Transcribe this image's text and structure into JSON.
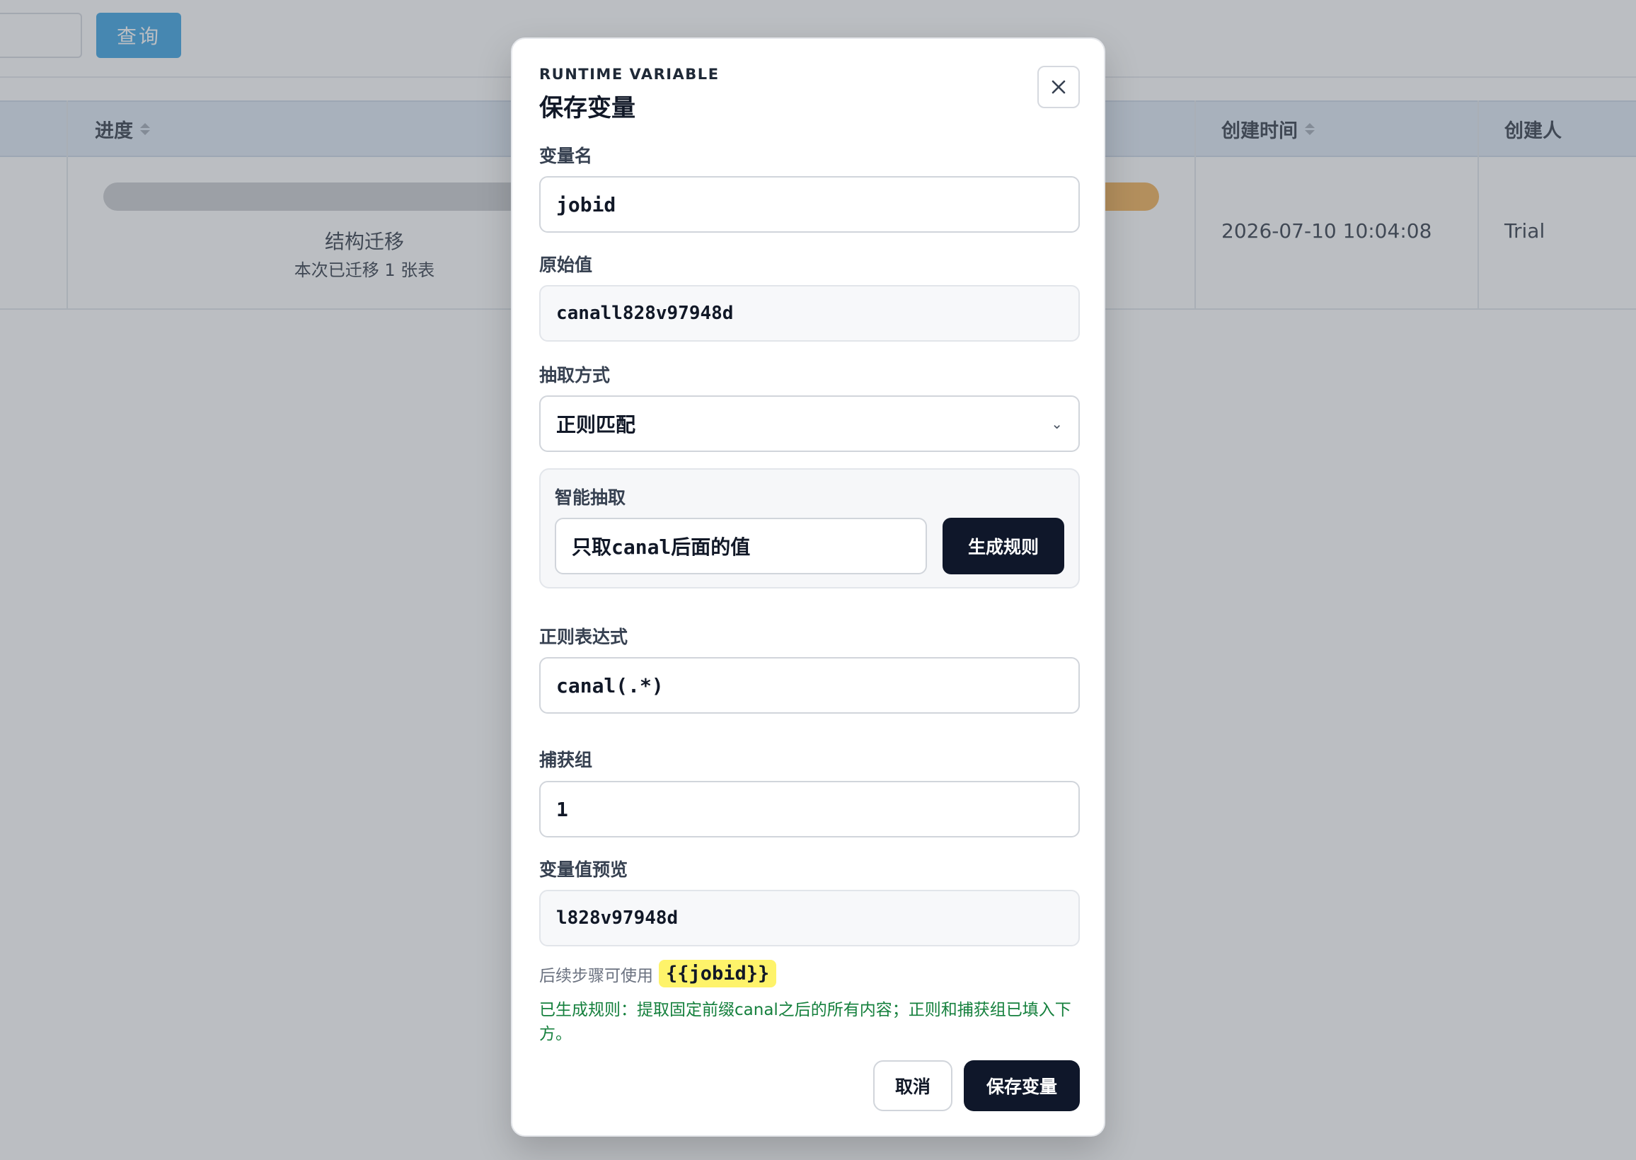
{
  "background": {
    "query_button": "查询",
    "table": {
      "headers": [
        {
          "label": "进度",
          "sortable": true
        },
        {
          "label": "创建时间",
          "sortable": true
        },
        {
          "label": "创建人",
          "sortable": false
        }
      ],
      "row": {
        "stage": "结构迁移",
        "stage_sub": "本次已迁移 1 张表",
        "created_at": "2026-07-10 10:04:08",
        "creator": "Trial"
      }
    }
  },
  "modal": {
    "eyebrow": "RUNTIME VARIABLE",
    "title": "保存变量",
    "fields": {
      "name_label": "变量名",
      "name_value": "jobid",
      "raw_label": "原始值",
      "raw_value": "canall828v97948d",
      "method_label": "抽取方式",
      "method_value": "正则匹配",
      "smart_label": "智能抽取",
      "smart_value": "只取canal后面的值",
      "generate_button": "生成规则",
      "regex_label": "正则表达式",
      "regex_value": "canal(.*)",
      "group_label": "捕获组",
      "group_value": "1",
      "preview_label": "变量值预览",
      "preview_value": "l828v97948d"
    },
    "hint_text": "后续步骤可使用",
    "hint_variable": "{{jobid}}",
    "success_message": "已生成规则：提取固定前缀canal之后的所有内容；正则和捕获组已填入下方。",
    "cancel_button": "取消",
    "save_button": "保存变量"
  },
  "colors": {
    "query_button": "#2b9be0",
    "primary_dark": "#0f172a",
    "success_text": "#15803d",
    "highlight": "#fef36a",
    "progress_orange": "#f0a948",
    "table_header": "#dce8f5"
  },
  "icons": {
    "close": "close-icon",
    "select": "chevron-down-icon",
    "sort": "sort-icon"
  }
}
